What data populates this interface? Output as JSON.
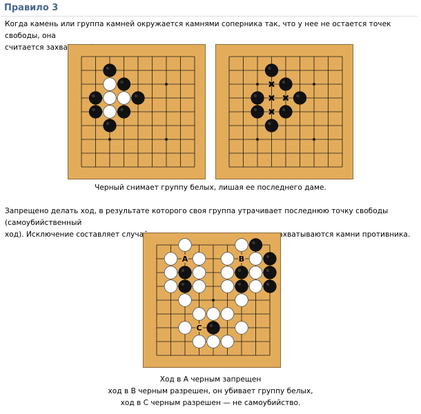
{
  "header": {
    "title": "Правило 3"
  },
  "rule_text": [
    "Когда камень или группа камней окружается камнями соперника так, что у нее не остается точек свободы, она",
    "считается захваченной и снимается с доски."
  ],
  "capture_caption": "Черный снимает группу белых, лишая ее последнего даме.",
  "suicide_text": [
    "Запрещено делать ход, в результате которого своя группа утрачивает последнюю точку свободы (самоубийственный",
    "ход). Исключение составляет случай, когда в результате этого хода захватываются камни противника."
  ],
  "suicide_caption": [
    "Ход в А черным запрещен",
    "ход в В черным разрешен, он убивает группу белых,",
    "ход в С черным разрешен — не самоубийство."
  ],
  "colors": {
    "board": "#e3ac5a",
    "title": "#45688e",
    "grid": "#1a1a1a",
    "black_stone": "#111111",
    "white_stone": "#ffffff"
  },
  "boards": [
    {
      "name": "capture-before-board",
      "size": 9,
      "hoshi": [
        [
          2,
          2
        ],
        [
          6,
          2
        ],
        [
          2,
          6
        ],
        [
          6,
          6
        ]
      ],
      "stones": [
        {
          "c": 2,
          "r": 1,
          "color": "black"
        },
        {
          "c": 2,
          "r": 2,
          "color": "white"
        },
        {
          "c": 3,
          "r": 2,
          "color": "black"
        },
        {
          "c": 1,
          "r": 3,
          "color": "black"
        },
        {
          "c": 2,
          "r": 3,
          "color": "white"
        },
        {
          "c": 3,
          "r": 3,
          "color": "white"
        },
        {
          "c": 4,
          "r": 3,
          "color": "black"
        },
        {
          "c": 1,
          "r": 4,
          "color": "black"
        },
        {
          "c": 2,
          "r": 4,
          "color": "white"
        },
        {
          "c": 3,
          "r": 4,
          "color": "black"
        },
        {
          "c": 2,
          "r": 5,
          "color": "black"
        }
      ],
      "marks": []
    },
    {
      "name": "capture-after-board",
      "size": 9,
      "hoshi": [
        [
          2,
          2
        ],
        [
          6,
          2
        ],
        [
          2,
          6
        ],
        [
          6,
          6
        ]
      ],
      "stones": [
        {
          "c": 3,
          "r": 1,
          "color": "black"
        },
        {
          "c": 4,
          "r": 2,
          "color": "black"
        },
        {
          "c": 2,
          "r": 3,
          "color": "black"
        },
        {
          "c": 5,
          "r": 3,
          "color": "black"
        },
        {
          "c": 2,
          "r": 4,
          "color": "black"
        },
        {
          "c": 4,
          "r": 4,
          "color": "black"
        },
        {
          "c": 3,
          "r": 5,
          "color": "black"
        }
      ],
      "marks": [
        {
          "c": 3,
          "r": 2,
          "type": "x"
        },
        {
          "c": 3,
          "r": 3,
          "type": "x"
        },
        {
          "c": 4,
          "r": 3,
          "type": "x"
        },
        {
          "c": 3,
          "r": 4,
          "type": "x"
        }
      ]
    },
    {
      "name": "suicide-board",
      "size": 9,
      "hoshi": [
        [
          2,
          2
        ],
        [
          6,
          2
        ],
        [
          2,
          6
        ],
        [
          6,
          6
        ],
        [
          4,
          4
        ]
      ],
      "stones": [
        {
          "c": 2,
          "r": 0,
          "color": "white"
        },
        {
          "c": 6,
          "r": 0,
          "color": "white"
        },
        {
          "c": 7,
          "r": 0,
          "color": "black"
        },
        {
          "c": 1,
          "r": 1,
          "color": "white"
        },
        {
          "c": 3,
          "r": 1,
          "color": "white"
        },
        {
          "c": 5,
          "r": 1,
          "color": "white"
        },
        {
          "c": 7,
          "r": 1,
          "color": "white"
        },
        {
          "c": 8,
          "r": 1,
          "color": "black"
        },
        {
          "c": 1,
          "r": 2,
          "color": "white"
        },
        {
          "c": 2,
          "r": 2,
          "color": "black"
        },
        {
          "c": 3,
          "r": 2,
          "color": "white"
        },
        {
          "c": 5,
          "r": 2,
          "color": "white"
        },
        {
          "c": 6,
          "r": 2,
          "color": "black"
        },
        {
          "c": 7,
          "r": 2,
          "color": "white"
        },
        {
          "c": 8,
          "r": 2,
          "color": "black"
        },
        {
          "c": 1,
          "r": 3,
          "color": "white"
        },
        {
          "c": 2,
          "r": 3,
          "color": "black"
        },
        {
          "c": 3,
          "r": 3,
          "color": "white"
        },
        {
          "c": 5,
          "r": 3,
          "color": "white"
        },
        {
          "c": 6,
          "r": 3,
          "color": "black"
        },
        {
          "c": 7,
          "r": 3,
          "color": "white"
        },
        {
          "c": 8,
          "r": 3,
          "color": "black"
        },
        {
          "c": 2,
          "r": 4,
          "color": "white"
        },
        {
          "c": 6,
          "r": 4,
          "color": "white"
        },
        {
          "c": 3,
          "r": 5,
          "color": "white"
        },
        {
          "c": 4,
          "r": 5,
          "color": "white"
        },
        {
          "c": 5,
          "r": 5,
          "color": "white"
        },
        {
          "c": 2,
          "r": 6,
          "color": "white"
        },
        {
          "c": 4,
          "r": 6,
          "color": "black"
        },
        {
          "c": 6,
          "r": 6,
          "color": "white"
        },
        {
          "c": 3,
          "r": 7,
          "color": "white"
        },
        {
          "c": 4,
          "r": 7,
          "color": "white"
        },
        {
          "c": 5,
          "r": 7,
          "color": "white"
        }
      ],
      "marks": [
        {
          "c": 2,
          "r": 1,
          "type": "label",
          "text": "A"
        },
        {
          "c": 6,
          "r": 1,
          "type": "label",
          "text": "B"
        },
        {
          "c": 3,
          "r": 6,
          "type": "label",
          "text": "C"
        }
      ]
    }
  ]
}
